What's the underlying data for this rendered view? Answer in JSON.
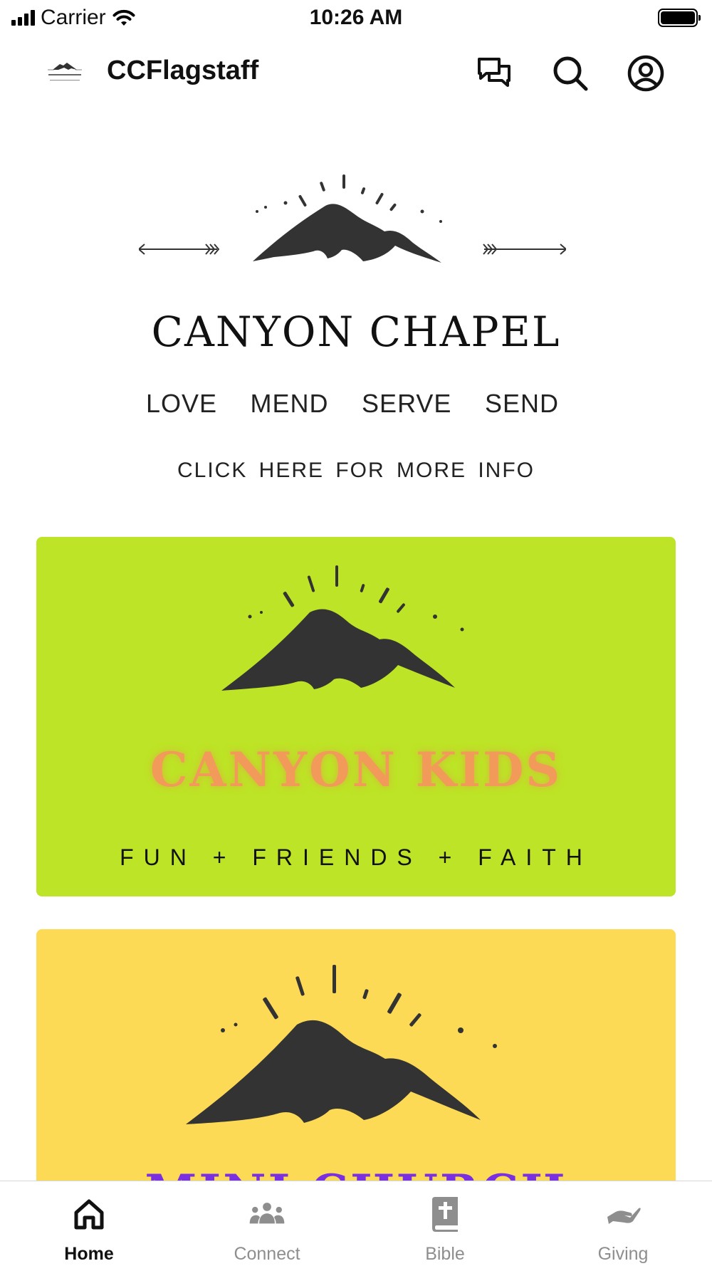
{
  "status_bar": {
    "carrier": "Carrier",
    "time": "10:26 AM"
  },
  "header": {
    "title": "CCFlagstaff",
    "icons": [
      "chat-icon",
      "search-icon",
      "profile-icon"
    ]
  },
  "chapel_banner": {
    "title": "CANYON CHAPEL",
    "tags": [
      "LOVE",
      "MEND",
      "SERVE",
      "SEND"
    ],
    "cta": "CLICK HERE FOR MORE INFO"
  },
  "kids_card": {
    "title": "CANYON KIDS",
    "subtitle": "FUN + FRIENDS + FAITH",
    "background": "#bde426",
    "title_color": "#f19a5a"
  },
  "mini_church_card": {
    "title": "MINI CHURCH",
    "background": "#fdda55",
    "title_color": "#7a2fe0"
  },
  "tab_bar": {
    "active_color": "#111111",
    "inactive_color": "#8e8e8e",
    "tabs": [
      {
        "label": "Home",
        "icon": "home-icon",
        "active": true
      },
      {
        "label": "Connect",
        "icon": "group-icon",
        "active": false
      },
      {
        "label": "Bible",
        "icon": "bible-icon",
        "active": false
      },
      {
        "label": "Giving",
        "icon": "giving-hand-icon",
        "active": false
      }
    ]
  },
  "colors": {
    "mountain": "#333333"
  }
}
